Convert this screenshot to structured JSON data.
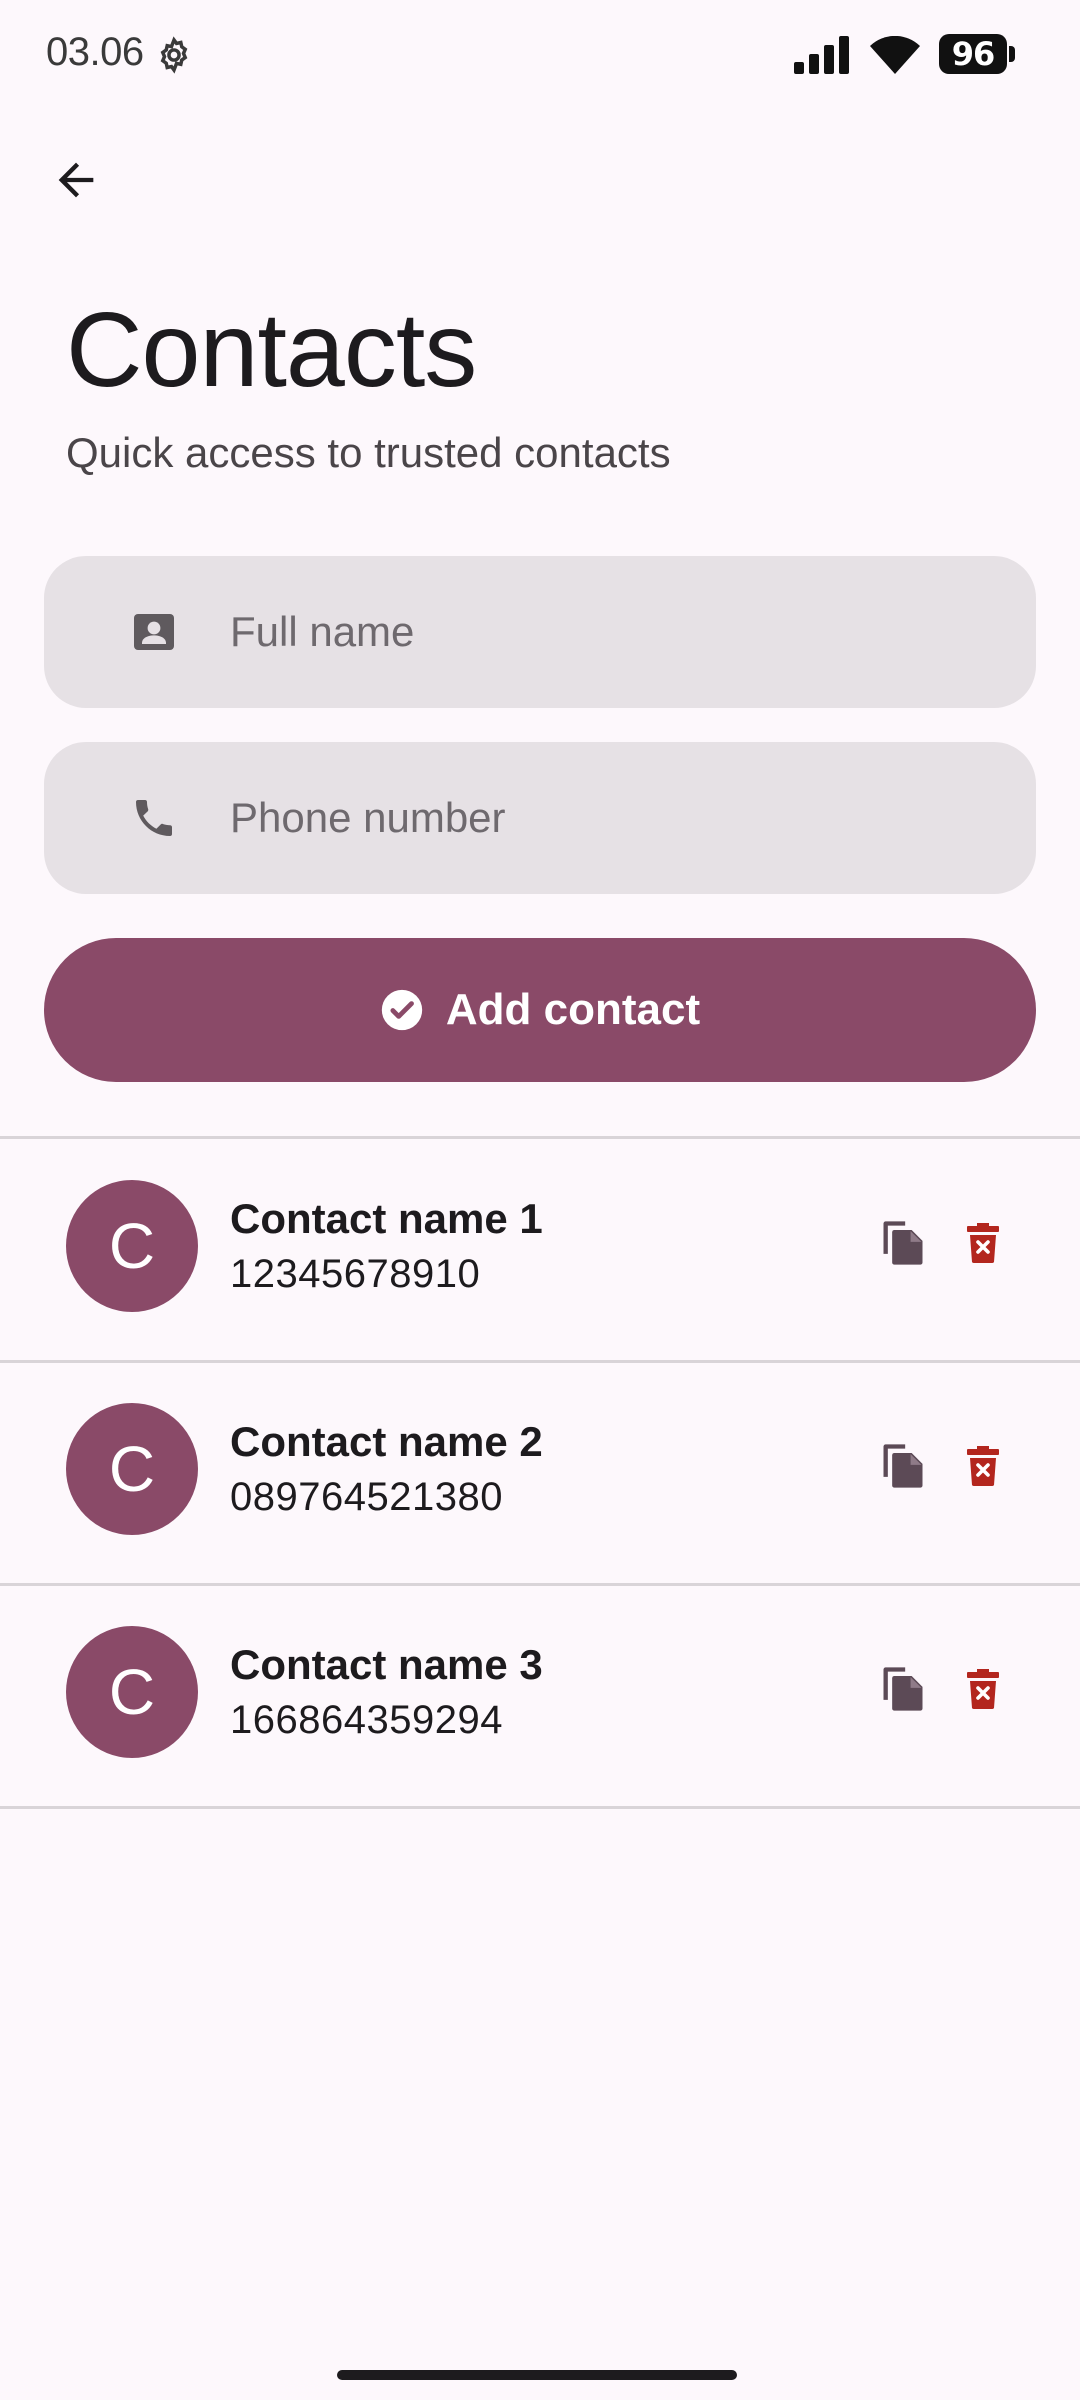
{
  "status_bar": {
    "time": "03.06",
    "battery": "96",
    "icons": [
      "gear-icon",
      "signal-icon",
      "wifi-icon",
      "battery-icon"
    ]
  },
  "header": {
    "back_icon": "arrow-left-icon",
    "title": "Contacts",
    "subtitle": "Quick access to trusted contacts"
  },
  "form": {
    "name_field": {
      "placeholder": "Full name",
      "value": "",
      "icon": "contact-card-icon"
    },
    "phone_field": {
      "placeholder": "Phone number",
      "value": "",
      "icon": "phone-icon"
    },
    "add_button": {
      "label": "Add contact",
      "icon": "check-circle-icon"
    }
  },
  "contacts": [
    {
      "initial": "C",
      "name": "Contact name 1",
      "phone": "12345678910"
    },
    {
      "initial": "C",
      "name": "Contact name 2",
      "phone": "089764521380"
    },
    {
      "initial": "C",
      "name": "Contact name 3",
      "phone": "166864359294"
    }
  ],
  "row_actions": {
    "copy_icon": "copy-icon",
    "delete_icon": "delete-icon"
  },
  "colors": {
    "accent": "#8a4a68",
    "field_background": "#e6e1e5",
    "background": "#fdf8fc",
    "delete": "#b3261e",
    "copy": "#5c4a56"
  }
}
